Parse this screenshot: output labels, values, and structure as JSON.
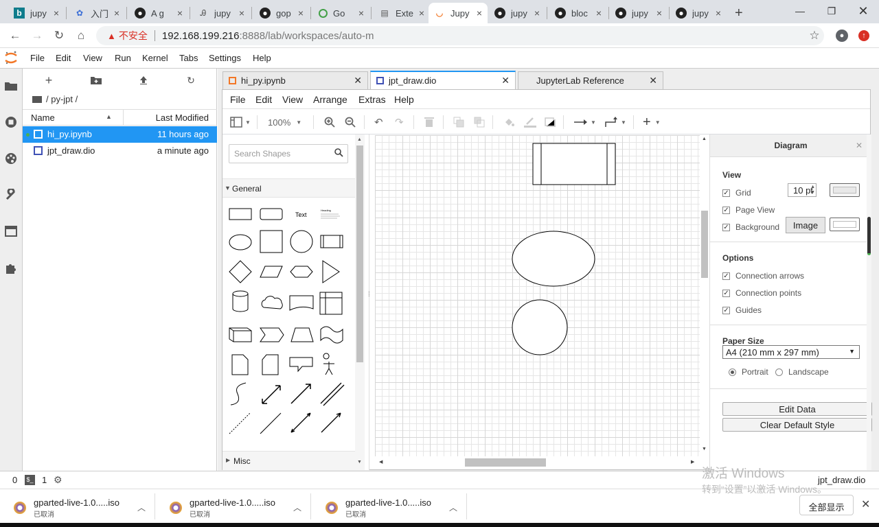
{
  "browser": {
    "tabs": [
      {
        "label": "jupy",
        "icon": "bing-icon",
        "color": "#0f7c8c"
      },
      {
        "label": "入门",
        "icon": "baidu-icon",
        "color": "#3b6ed6"
      },
      {
        "label": "A g",
        "icon": "github-icon",
        "color": "#222222"
      },
      {
        "label": "jupy",
        "icon": "jianshu-icon",
        "color": "#555555"
      },
      {
        "label": "gop",
        "icon": "github-icon",
        "color": "#222222"
      },
      {
        "label": "Go",
        "icon": "circle-icon",
        "color": "#43a047"
      },
      {
        "label": "Exte",
        "icon": "docs-icon",
        "color": "#555555"
      },
      {
        "label": "Jupy",
        "icon": "jupyter-icon",
        "color": "#f37726"
      },
      {
        "label": "jupy",
        "icon": "github-icon",
        "color": "#222222"
      },
      {
        "label": "bloc",
        "icon": "github-icon",
        "color": "#222222"
      },
      {
        "label": "jupy",
        "icon": "github-icon",
        "color": "#222222"
      },
      {
        "label": "jupy",
        "icon": "github-icon",
        "color": "#222222"
      }
    ],
    "tab_close": "×",
    "new_tab": "+",
    "address": {
      "warning": "▲",
      "insecure": "不安全",
      "host": "192.168.199.216",
      "path": ":8888/lab/workspaces/auto-m"
    }
  },
  "jupyter": {
    "menu": [
      "File",
      "Edit",
      "View",
      "Run",
      "Kernel",
      "Tabs",
      "Settings",
      "Help"
    ],
    "breadcrumb": "/ py-jpt /",
    "columns": {
      "name": "Name",
      "modified": "Last Modified"
    },
    "files": [
      {
        "name": "hi_py.ipynb",
        "modified": "11 hours ago",
        "selected": true
      },
      {
        "name": "jpt_draw.dio",
        "modified": "a minute ago",
        "selected": false
      }
    ],
    "doc_tabs": [
      {
        "label": "hi_py.ipynb"
      },
      {
        "label": "jpt_draw.dio"
      },
      {
        "label": "JupyterLab Reference"
      }
    ],
    "status": {
      "terminals": "0",
      "kernels": "1",
      "current_file": "jpt_draw.dio"
    }
  },
  "drawio": {
    "menu": [
      "File",
      "Edit",
      "View",
      "Arrange",
      "Extras",
      "Help"
    ],
    "zoom": "100%",
    "search_placeholder": "Search Shapes",
    "shape_groups": {
      "general": "General",
      "misc": "Misc"
    },
    "shape_text": {
      "text": "Text",
      "heading": "Heading"
    },
    "format": {
      "title": "Diagram",
      "view_heading": "View",
      "grid": "Grid",
      "grid_size": "10 pt",
      "page_view": "Page View",
      "background": "Background",
      "image_button": "Image",
      "options_heading": "Options",
      "connection_arrows": "Connection arrows",
      "connection_points": "Connection points",
      "guides": "Guides",
      "paper_heading": "Paper Size",
      "paper_size": "A4 (210 mm x 297 mm)",
      "portrait": "Portrait",
      "landscape": "Landscape",
      "edit_data": "Edit Data",
      "clear_style": "Clear Default Style"
    }
  },
  "downloads": [
    {
      "name": "gparted-live-1.0.....iso",
      "status": "已取消"
    },
    {
      "name": "gparted-live-1.0.....iso",
      "status": "已取消"
    },
    {
      "name": "gparted-live-1.0.....iso",
      "status": "已取消"
    }
  ],
  "show_all": "全部显示",
  "activation": {
    "line1": "激活 Windows",
    "line2": "转到“设置”以激活 Windows。"
  }
}
